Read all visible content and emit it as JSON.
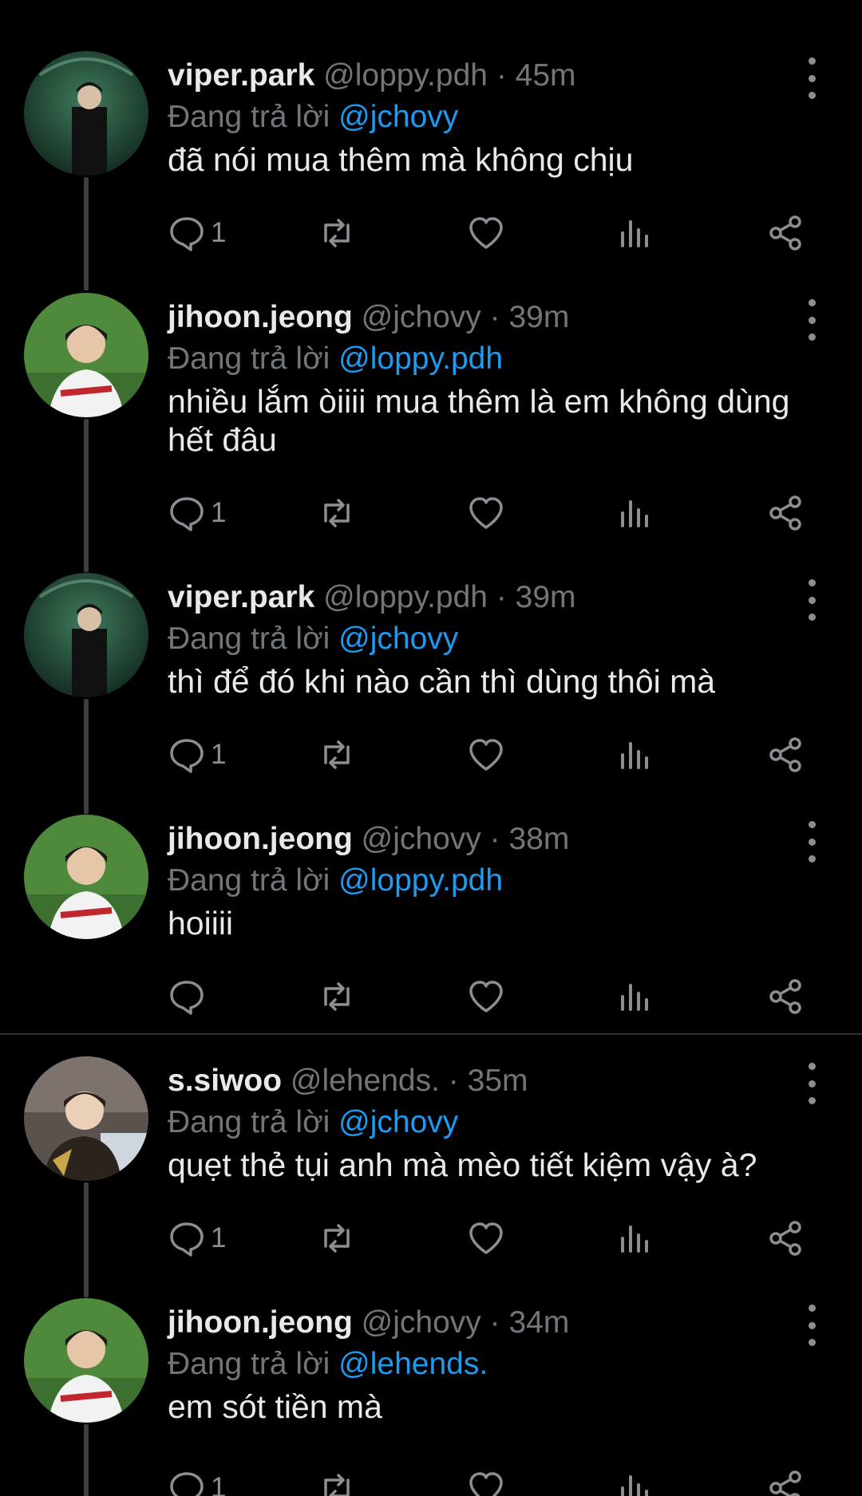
{
  "thread": [
    {
      "avatar": "viper-photo",
      "name": "viper.park",
      "handle": "@loppy.pdh",
      "sep": "·",
      "time": "45m",
      "reply_prefix": "Đang trả lời",
      "reply_to": "@jchovy",
      "text": "đã nói mua thêm mà không chịu",
      "reply_count": "1"
    },
    {
      "avatar": "jihoon-photo",
      "name": "jihoon.jeong",
      "handle": "@jchovy",
      "sep": "·",
      "time": "39m",
      "reply_prefix": "Đang trả lời",
      "reply_to": "@loppy.pdh",
      "text": "nhiều lắm òiiii mua thêm là em không dùng hết đâu",
      "reply_count": "1"
    },
    {
      "avatar": "viper-photo",
      "name": "viper.park",
      "handle": "@loppy.pdh",
      "sep": "·",
      "time": "39m",
      "reply_prefix": "Đang trả lời",
      "reply_to": "@jchovy",
      "text": "thì để đó khi nào cần thì dùng thôi mà",
      "reply_count": "1"
    },
    {
      "avatar": "jihoon-photo",
      "name": "jihoon.jeong",
      "handle": "@jchovy",
      "sep": "·",
      "time": "38m",
      "reply_prefix": "Đang trả lời",
      "reply_to": "@loppy.pdh",
      "text": "hoiiii",
      "reply_count": ""
    },
    {
      "avatar": "siwoo-photo",
      "name": "s.siwoo",
      "handle": "@lehends.",
      "sep": "·",
      "time": "35m",
      "reply_prefix": "Đang trả lời",
      "reply_to": "@jchovy",
      "text": "quẹt thẻ tụi anh mà mèo tiết kiệm vậy à?",
      "reply_count": "1"
    },
    {
      "avatar": "jihoon-photo",
      "name": "jihoon.jeong",
      "handle": "@jchovy",
      "sep": "·",
      "time": "34m",
      "reply_prefix": "Đang trả lời",
      "reply_to": "@lehends.",
      "text": "em sót tiền mà",
      "reply_count": "1"
    }
  ],
  "colors": {
    "background": "#000000",
    "text": "#e7e9ea",
    "muted": "#71767b",
    "link": "#1d9bf0",
    "thread_line": "#3a3f44"
  }
}
